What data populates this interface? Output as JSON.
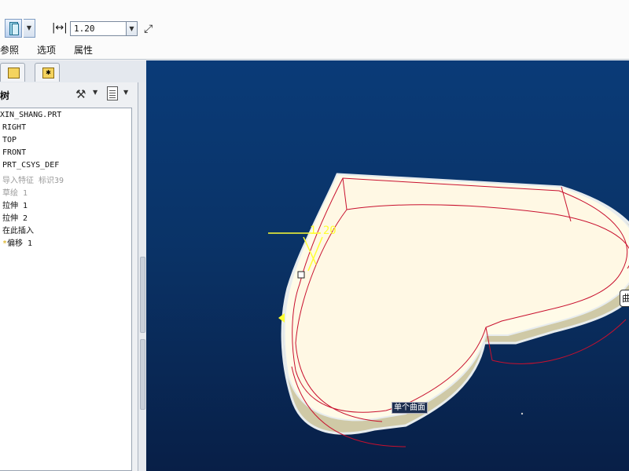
{
  "dashboard": {
    "icon_button": "solid-thicken-icon",
    "thickness_icon": "thickness-dimension-icon",
    "thickness_value": "1.20",
    "flip_icon": "flip-direction-icon",
    "tabs": [
      "参照",
      "选项",
      "属性"
    ]
  },
  "navigator": {
    "tabs": [
      "model-tree-icon",
      "folder-browser-icon"
    ],
    "tree_title": "树",
    "tree_items": [
      {
        "label": "XIN_SHANG.PRT",
        "dim": false
      },
      {
        "label": "RIGHT",
        "dim": false
      },
      {
        "label": "TOP",
        "dim": false
      },
      {
        "label": "FRONT",
        "dim": false
      },
      {
        "label": "PRT_CSYS_DEF",
        "dim": false
      },
      {
        "label": "导入特征 标识39",
        "dim": true
      },
      {
        "label": "草绘 1",
        "dim": true
      },
      {
        "label": "拉伸 1",
        "dim": false
      },
      {
        "label": "拉伸 2",
        "dim": false
      },
      {
        "label": "在此插入",
        "dim": false
      },
      {
        "label": "偏移 1",
        "dim": false,
        "icon": "*"
      }
    ]
  },
  "graphics": {
    "dimension_label": "1.20",
    "surface_label": "单个曲面",
    "side_tag": "曲"
  }
}
